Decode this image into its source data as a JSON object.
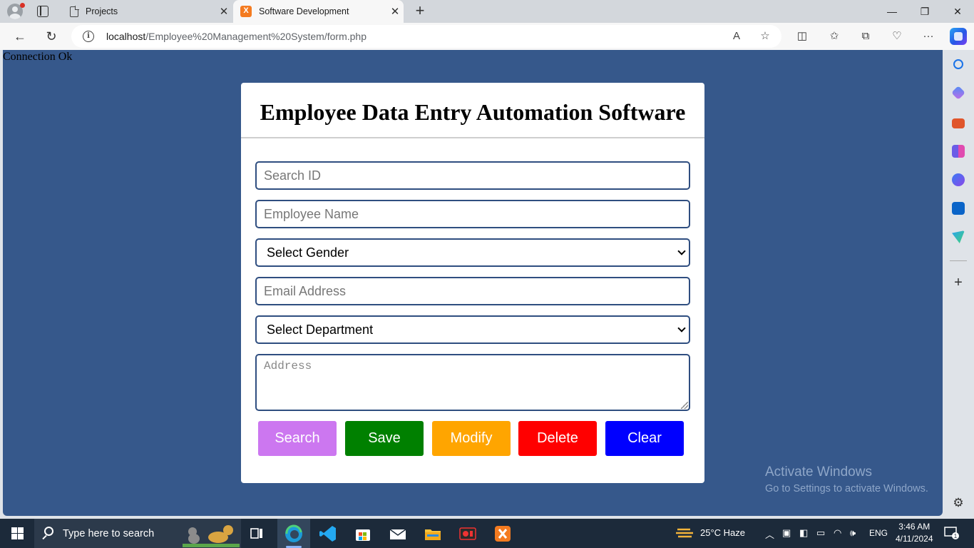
{
  "browser": {
    "tabs": [
      {
        "title": "Projects",
        "active": false
      },
      {
        "title": "Software Development",
        "active": true
      }
    ],
    "url_host": "localhost",
    "url_path": "/Employee%20Management%20System/form.php"
  },
  "page": {
    "status_text": "Connection Ok",
    "heading": "Employee Data Entry Automation Software",
    "form": {
      "search_id_placeholder": "Search ID",
      "name_placeholder": "Employee Name",
      "gender_select": "Select Gender",
      "email_placeholder": "Email Address",
      "department_select": "Select Department",
      "address_placeholder": "Address"
    },
    "buttons": [
      {
        "label": "Search",
        "color": "#cc77f0"
      },
      {
        "label": "Save",
        "color": "#008000"
      },
      {
        "label": "Modify",
        "color": "#ffa500"
      },
      {
        "label": "Delete",
        "color": "#ff0000"
      },
      {
        "label": "Clear",
        "color": "#0000ff"
      }
    ],
    "background_color": "#36588b"
  },
  "watermark": {
    "line1": "Activate Windows",
    "line2": "Go to Settings to activate Windows."
  },
  "taskbar": {
    "search_placeholder": "Type here to search",
    "weather": "25°C  Haze",
    "language": "ENG",
    "time": "3:46 AM",
    "date": "4/11/2024",
    "notification_count": "1"
  }
}
